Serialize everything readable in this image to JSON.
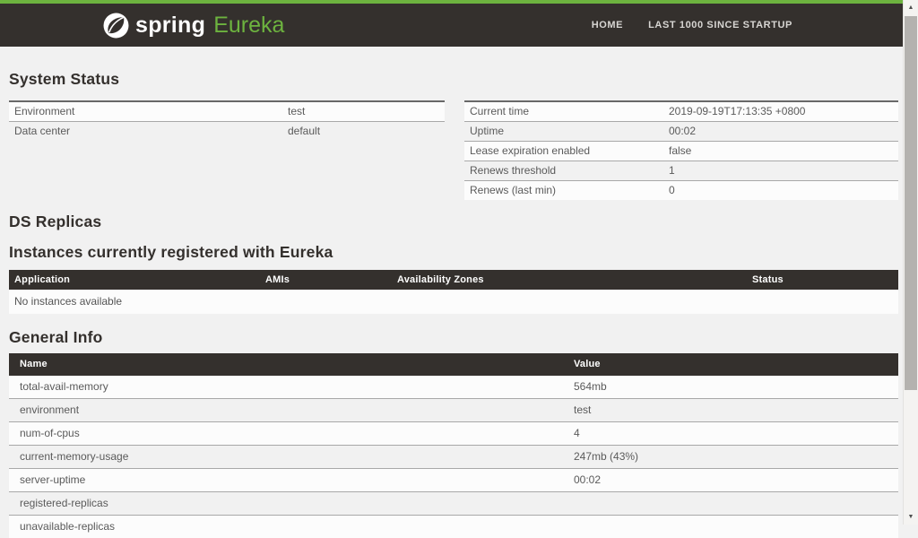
{
  "colors": {
    "accent_green": "#6db33f",
    "navbar_bg": "#34302d",
    "page_bg": "#f1f1f1"
  },
  "navbar": {
    "brand": {
      "spring": "spring",
      "product": "Eureka"
    },
    "links": [
      {
        "label": "HOME"
      },
      {
        "label": "LAST 1000 SINCE STARTUP"
      }
    ]
  },
  "system_status": {
    "heading": "System Status",
    "left_rows": [
      {
        "label": "Environment",
        "value": "test"
      },
      {
        "label": "Data center",
        "value": "default"
      }
    ],
    "right_rows": [
      {
        "label": "Current time",
        "value": "2019-09-19T17:13:35 +0800"
      },
      {
        "label": "Uptime",
        "value": "00:02"
      },
      {
        "label": "Lease expiration enabled",
        "value": "false"
      },
      {
        "label": "Renews threshold",
        "value": "1"
      },
      {
        "label": "Renews (last min)",
        "value": "0"
      }
    ]
  },
  "ds_replicas": {
    "heading": "DS Replicas"
  },
  "instances": {
    "heading": "Instances currently registered with Eureka",
    "columns": [
      "Application",
      "AMIs",
      "Availability Zones",
      "Status"
    ],
    "empty_message": "No instances available"
  },
  "general_info": {
    "heading": "General Info",
    "columns": [
      "Name",
      "Value"
    ],
    "rows": [
      {
        "name": "total-avail-memory",
        "value": "564mb"
      },
      {
        "name": "environment",
        "value": "test"
      },
      {
        "name": "num-of-cpus",
        "value": "4"
      },
      {
        "name": "current-memory-usage",
        "value": "247mb (43%)"
      },
      {
        "name": "server-uptime",
        "value": "00:02"
      },
      {
        "name": "registered-replicas",
        "value": ""
      },
      {
        "name": "unavailable-replicas",
        "value": ""
      }
    ]
  },
  "scrollbar": {
    "up_arrow": "▲",
    "down_arrow": "▼"
  }
}
